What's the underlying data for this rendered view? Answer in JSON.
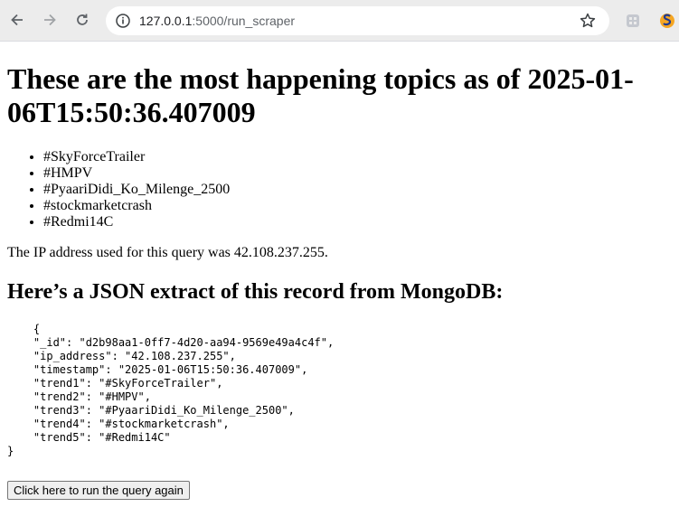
{
  "browser": {
    "url_host": "127.0.0.1",
    "url_rest": ":5000/run_scraper",
    "icons": [
      "back-icon",
      "forward-icon",
      "reload-icon",
      "info-icon",
      "star-icon",
      "extension-icon",
      "profile-icon"
    ]
  },
  "page": {
    "heading": "These are the most happening topics as of 2025-01-06T15:50:36.407009",
    "trends": [
      "#SkyForceTrailer",
      "#HMPV",
      "#PyaariDidi_Ko_Milenge_2500",
      "#stockmarketcrash",
      "#Redmi14C"
    ],
    "ip_sentence": "The IP address used for this query was 42.108.237.255.",
    "json_heading": "Here’s a JSON extract of this record from MongoDB:",
    "json_extract": "    {\n    \"_id\": \"d2b98aa1-0ff7-4d20-aa94-9569e49a4c4f\",\n    \"ip_address\": \"42.108.237.255\",\n    \"timestamp\": \"2025-01-06T15:50:36.407009\",\n    \"trend1\": \"#SkyForceTrailer\",\n    \"trend2\": \"#HMPV\",\n    \"trend3\": \"#PyaariDidi_Ko_Milenge_2500\",\n    \"trend4\": \"#stockmarketcrash\",\n    \"trend5\": \"#Redmi14C\"\n}",
    "button_label": "Click here to run the query again"
  }
}
